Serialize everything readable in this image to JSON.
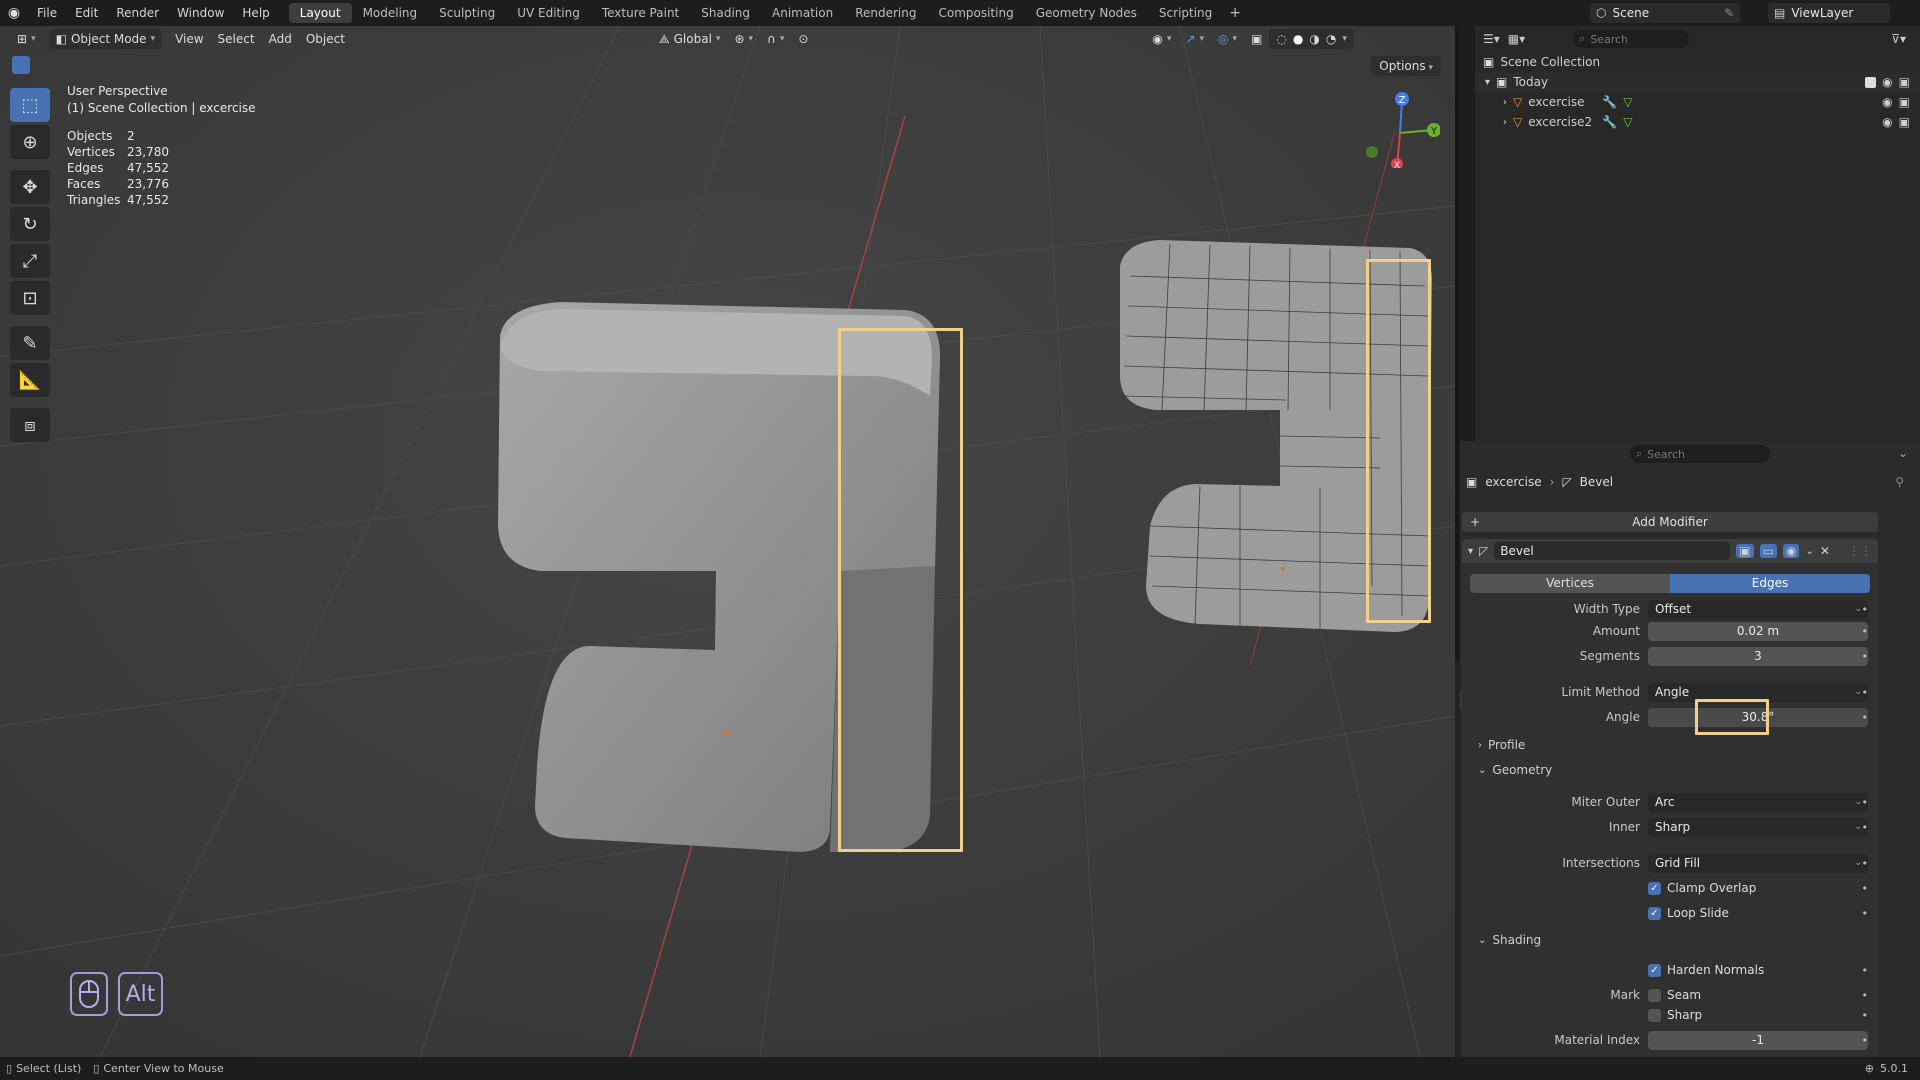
{
  "menu": {
    "items": [
      "File",
      "Edit",
      "Render",
      "Window",
      "Help"
    ]
  },
  "workspaces": {
    "tabs": [
      "Layout",
      "Modeling",
      "Sculpting",
      "UV Editing",
      "Texture Paint",
      "Shading",
      "Animation",
      "Rendering",
      "Compositing",
      "Geometry Nodes",
      "Scripting"
    ],
    "active": "Layout",
    "add_icon": "plus-icon"
  },
  "scene": {
    "name": "Scene",
    "view_layer": "ViewLayer"
  },
  "viewport": {
    "mode": "Object Mode",
    "menus": [
      "View",
      "Select",
      "Add",
      "Object"
    ],
    "orientation": "Global",
    "options_label": "Options",
    "overlay_title": "User Perspective",
    "overlay_collection": "(1) Scene Collection | excercise",
    "stats": [
      {
        "label": "Objects",
        "value": "2"
      },
      {
        "label": "Vertices",
        "value": "23,780"
      },
      {
        "label": "Edges",
        "value": "47,552"
      },
      {
        "label": "Faces",
        "value": "23,776"
      },
      {
        "label": "Triangles",
        "value": "47,552"
      }
    ],
    "gizmo": {
      "z": "Z",
      "y": "Y",
      "x": "X"
    },
    "key_hints": {
      "mouse_icon": "mouse-icon",
      "alt_key": "Alt"
    },
    "highlight_color": "#f5cf8a"
  },
  "outliner": {
    "search_placeholder": "Search",
    "root": "Scene Collection",
    "collection": "Today",
    "objects": [
      {
        "name": "excercise"
      },
      {
        "name": "excercise2"
      }
    ]
  },
  "properties": {
    "search_placeholder": "Search",
    "breadcrumb_object": "excercise",
    "breadcrumb_modifier": "Bevel",
    "add_modifier": "Add Modifier",
    "modifier_name": "Bevel",
    "affect_tabs": [
      "Vertices",
      "Edges"
    ],
    "affect_active": "Edges",
    "width_type_label": "Width Type",
    "width_type": "Offset",
    "amount_label": "Amount",
    "amount": "0.02 m",
    "segments_label": "Segments",
    "segments": "3",
    "limit_method_label": "Limit Method",
    "limit_method": "Angle",
    "angle_label": "Angle",
    "angle": "30.8°",
    "profile_label": "Profile",
    "geometry_label": "Geometry",
    "miter_outer_label": "Miter Outer",
    "miter_outer": "Arc",
    "inner_label": "Inner",
    "inner": "Sharp",
    "intersections_label": "Intersections",
    "intersections": "Grid Fill",
    "clamp_overlap": "Clamp Overlap",
    "loop_slide": "Loop Slide",
    "shading_label": "Shading",
    "harden_normals": "Harden Normals",
    "mark_label": "Mark",
    "seam": "Seam",
    "sharp": "Sharp",
    "material_index_label": "Material Index",
    "material_index": "-1"
  },
  "statusbar": {
    "select_hint": "Select (List)",
    "center_hint": "Center View to Mouse",
    "version": "5.0.1"
  }
}
